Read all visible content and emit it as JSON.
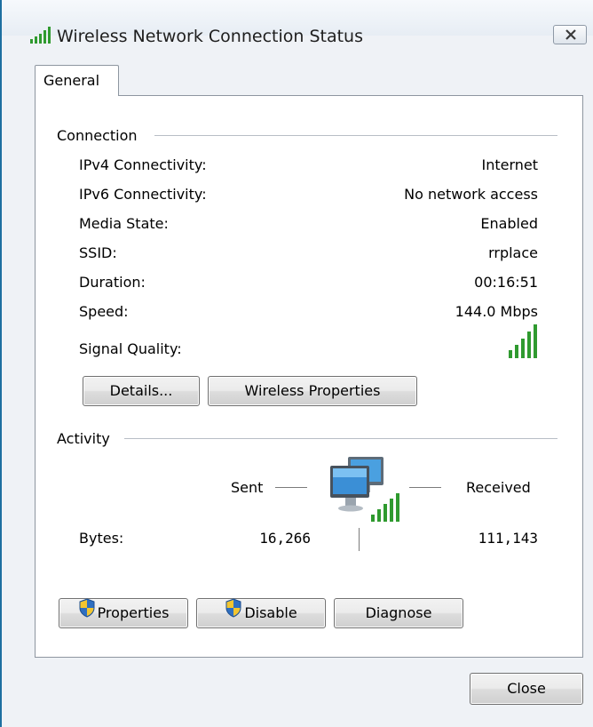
{
  "window": {
    "title": "Wireless Network Connection Status"
  },
  "tabs": [
    {
      "label": "General"
    }
  ],
  "connection": {
    "group_label": "Connection",
    "rows": [
      {
        "label": "IPv4 Connectivity:",
        "value": "Internet"
      },
      {
        "label": "IPv6 Connectivity:",
        "value": "No network access"
      },
      {
        "label": "Media State:",
        "value": "Enabled"
      },
      {
        "label": "SSID:",
        "value": "rrplace"
      },
      {
        "label": "Duration:",
        "value": "00:16:51"
      },
      {
        "label": "Speed:",
        "value": "144.0 Mbps"
      }
    ],
    "signal_label": "Signal Quality:",
    "signal_bars": 5,
    "details_button": "Details...",
    "wireless_properties_button": "Wireless Properties"
  },
  "activity": {
    "group_label": "Activity",
    "sent_label": "Sent",
    "received_label": "Received",
    "bytes_label": "Bytes:",
    "bytes_sent": "16,266",
    "bytes_received": "111,143"
  },
  "buttons": {
    "properties": "Properties",
    "disable": "Disable",
    "diagnose": "Diagnose",
    "close": "Close"
  },
  "colors": {
    "signal_green": "#2f9a2f",
    "window_border": "#1d6fa0"
  }
}
